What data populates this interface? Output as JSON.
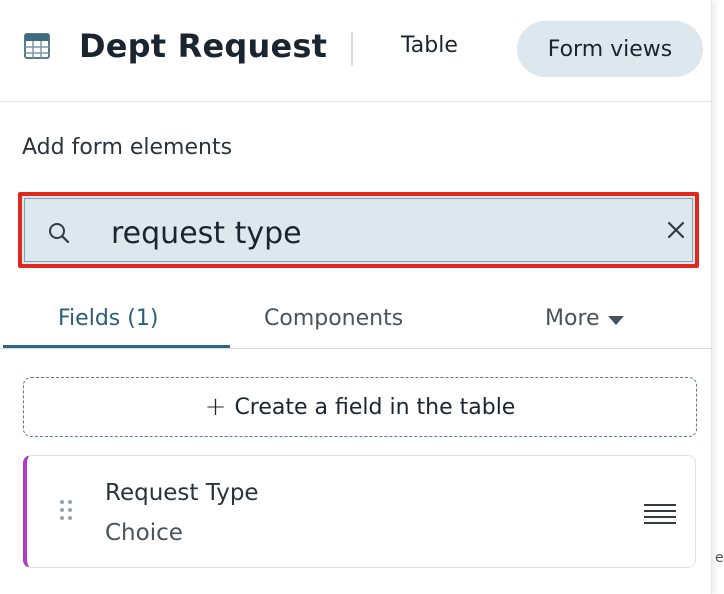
{
  "header": {
    "title": "Dept Request",
    "icon": "table-icon",
    "tabs": [
      "Table",
      "Form views"
    ],
    "active_tab": "Form views"
  },
  "panel": {
    "section_label": "Add form elements",
    "search": {
      "value": "request type",
      "placeholder": "",
      "highlight_color": "#e0281d"
    },
    "tabs": [
      {
        "label": "Fields (1)",
        "active": true
      },
      {
        "label": "Components",
        "active": false
      },
      {
        "label": "More",
        "active": false
      }
    ],
    "create_label": "Create a field in the table",
    "fields": [
      {
        "name": "Request Type",
        "type": "Choice",
        "accent": "#b53ac9"
      }
    ]
  },
  "edge_text": "e"
}
